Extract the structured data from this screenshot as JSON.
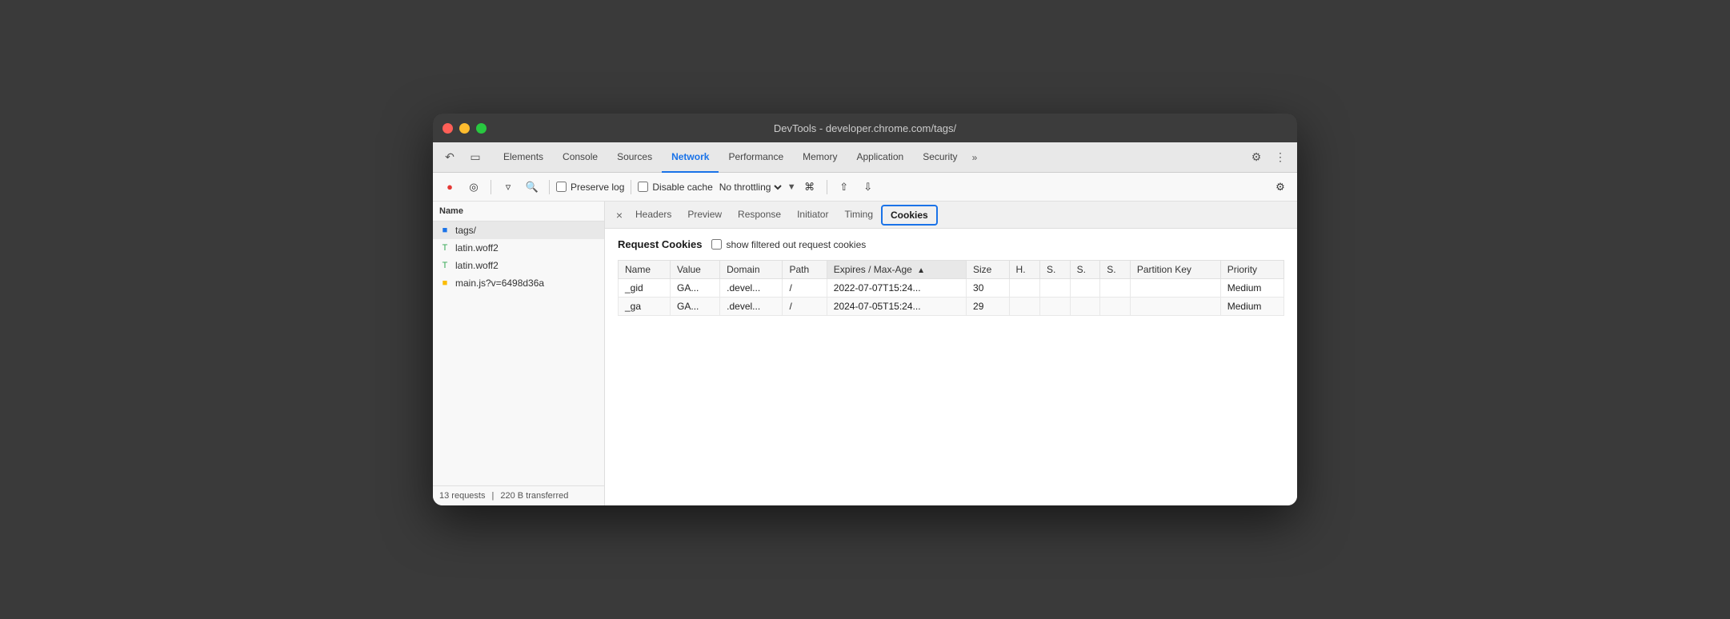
{
  "window": {
    "title": "DevTools - developer.chrome.com/tags/"
  },
  "tabs": {
    "items": [
      {
        "label": "Elements",
        "active": false
      },
      {
        "label": "Console",
        "active": false
      },
      {
        "label": "Sources",
        "active": false
      },
      {
        "label": "Network",
        "active": true
      },
      {
        "label": "Performance",
        "active": false
      },
      {
        "label": "Memory",
        "active": false
      },
      {
        "label": "Application",
        "active": false
      },
      {
        "label": "Security",
        "active": false
      }
    ],
    "more_label": "»"
  },
  "toolbar": {
    "preserve_log": "Preserve log",
    "disable_cache": "Disable cache",
    "throttle": "No throttling"
  },
  "sidebar": {
    "header": "Name",
    "items": [
      {
        "label": "tags/",
        "icon": "doc",
        "active": true
      },
      {
        "label": "latin.woff2",
        "icon": "font"
      },
      {
        "label": "latin.woff2",
        "icon": "font"
      },
      {
        "label": "main.js?v=6498d36a",
        "icon": "script"
      }
    ],
    "footer": {
      "requests": "13 requests",
      "transferred": "220 B transferred"
    }
  },
  "panel": {
    "close_label": "×",
    "tabs": [
      {
        "label": "Headers"
      },
      {
        "label": "Preview"
      },
      {
        "label": "Response"
      },
      {
        "label": "Initiator"
      },
      {
        "label": "Timing"
      },
      {
        "label": "Cookies",
        "highlighted": true
      }
    ]
  },
  "cookies": {
    "section_title": "Request Cookies",
    "show_filtered_label": "show filtered out request cookies",
    "columns": [
      {
        "key": "name",
        "label": "Name"
      },
      {
        "key": "value",
        "label": "Value"
      },
      {
        "key": "domain",
        "label": "Domain"
      },
      {
        "key": "path",
        "label": "Path"
      },
      {
        "key": "expires",
        "label": "Expires / Max-Age",
        "sorted": true,
        "sort_dir": "▲"
      },
      {
        "key": "size",
        "label": "Size"
      },
      {
        "key": "h",
        "label": "H."
      },
      {
        "key": "s1",
        "label": "S."
      },
      {
        "key": "s2",
        "label": "S."
      },
      {
        "key": "s3",
        "label": "S."
      },
      {
        "key": "partition_key",
        "label": "Partition Key"
      },
      {
        "key": "priority",
        "label": "Priority"
      }
    ],
    "rows": [
      {
        "name": "_gid",
        "value": "GA...",
        "domain": ".devel...",
        "path": "/",
        "expires": "2022-07-07T15:24...",
        "size": "30",
        "h": "",
        "s1": "",
        "s2": "",
        "s3": "",
        "partition_key": "",
        "priority": "Medium"
      },
      {
        "name": "_ga",
        "value": "GA...",
        "domain": ".devel...",
        "path": "/",
        "expires": "2024-07-05T15:24...",
        "size": "29",
        "h": "",
        "s1": "",
        "s2": "",
        "s3": "",
        "partition_key": "",
        "priority": "Medium"
      }
    ]
  }
}
